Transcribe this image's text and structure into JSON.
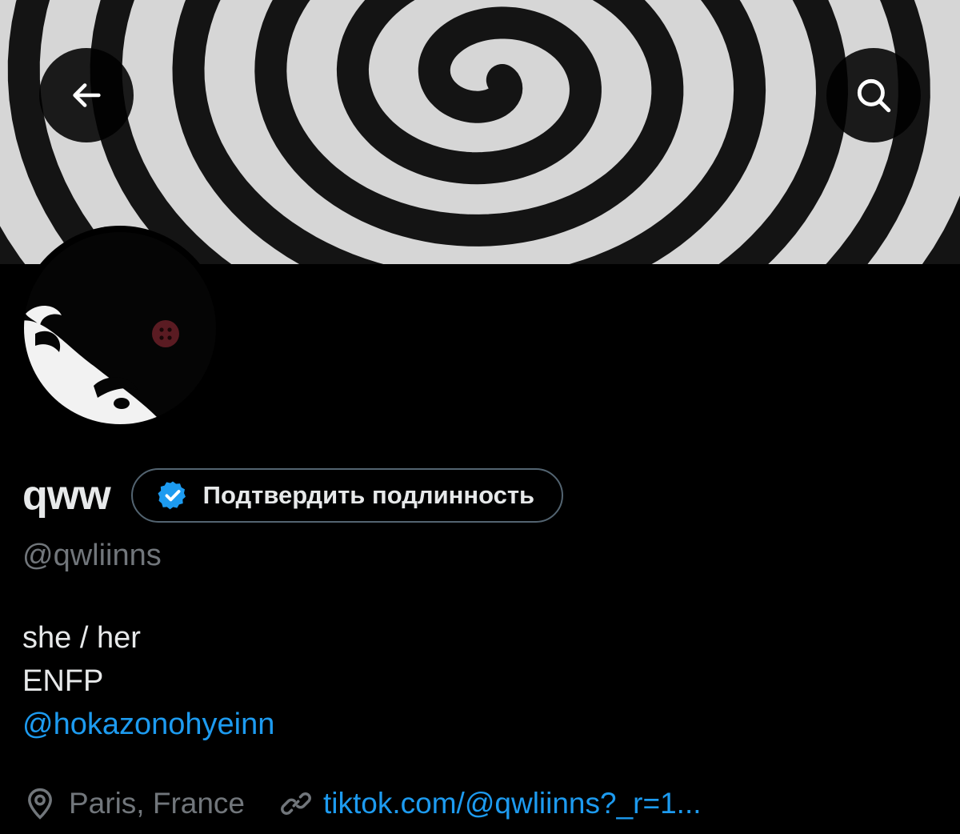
{
  "header": {
    "back_icon": "arrow-left-icon",
    "search_icon": "search-icon"
  },
  "profile": {
    "display_name": "qww",
    "verify_button_label": "Подтвердить подлинность",
    "verify_badge_icon": "verified-badge-icon",
    "handle": "@qwliinns",
    "bio_lines": [
      "she / her",
      "ENFP"
    ],
    "bio_mention": "@hokazonohyeinn",
    "location": "Paris, France",
    "website": "tiktok.com/@qwliinns?_r=1..."
  },
  "colors": {
    "background": "#000000",
    "text": "#e7e9ea",
    "secondary_text": "#71767b",
    "accent": "#1d9bf0",
    "border": "#536471"
  }
}
